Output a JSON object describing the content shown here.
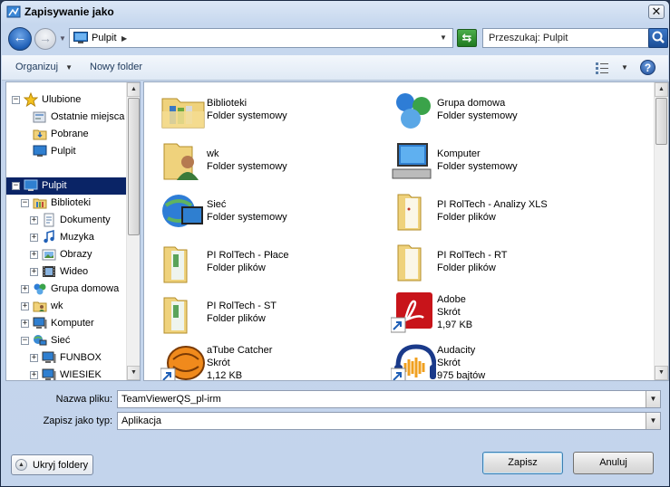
{
  "window": {
    "title": "Zapisywanie jako"
  },
  "address": {
    "location": "Pulpit"
  },
  "search": {
    "placeholder": "Przeszukaj: Pulpit"
  },
  "toolbar": {
    "organize": "Organizuj",
    "new_folder": "Nowy folder"
  },
  "nav": {
    "items": [
      {
        "label": "Ulubione",
        "icon": "star-icon"
      },
      {
        "label": "Ostatnie miejsca",
        "icon": "recent-places-icon"
      },
      {
        "label": "Pobrane",
        "icon": "downloads-folder-icon"
      },
      {
        "label": "Pulpit",
        "icon": "desktop-icon"
      },
      {
        "label": "Pulpit",
        "icon": "desktop-icon"
      },
      {
        "label": "Biblioteki",
        "icon": "libraries-icon"
      },
      {
        "label": "Dokumenty",
        "icon": "documents-icon"
      },
      {
        "label": "Muzyka",
        "icon": "music-icon"
      },
      {
        "label": "Obrazy",
        "icon": "pictures-icon"
      },
      {
        "label": "Wideo",
        "icon": "video-icon"
      },
      {
        "label": "Grupa domowa",
        "icon": "homegroup-icon"
      },
      {
        "label": "wk",
        "icon": "user-folder-icon"
      },
      {
        "label": "Komputer",
        "icon": "computer-icon"
      },
      {
        "label": "Sieć",
        "icon": "network-icon"
      },
      {
        "label": "FUNBOX",
        "icon": "network-computer-icon"
      },
      {
        "label": "WIESIEK",
        "icon": "network-computer-icon"
      }
    ]
  },
  "files": [
    {
      "name": "Biblioteki",
      "type": "Folder systemowy",
      "icon": "libraries-icon"
    },
    {
      "name": "Grupa domowa",
      "type": "Folder systemowy",
      "icon": "homegroup-icon"
    },
    {
      "name": "wk",
      "type": "Folder systemowy",
      "icon": "user-folder-icon"
    },
    {
      "name": "Komputer",
      "type": "Folder systemowy",
      "icon": "computer-icon"
    },
    {
      "name": "Sieć",
      "type": "Folder systemowy",
      "icon": "network-icon"
    },
    {
      "name": "PI RolTech - Analizy XLS",
      "type": "Folder plików",
      "icon": "folder-icon"
    },
    {
      "name": "PI RolTech - Płace",
      "type": "Folder plików",
      "icon": "folder-icon"
    },
    {
      "name": "PI RolTech - RT",
      "type": "Folder plików",
      "icon": "folder-icon"
    },
    {
      "name": "PI RolTech - ST",
      "type": "Folder plików",
      "icon": "folder-icon"
    },
    {
      "name": "Adobe",
      "type": "Skrót",
      "size": "1,97 KB",
      "icon": "adobe-reader-shortcut-icon"
    },
    {
      "name": "aTube Catcher",
      "type": "Skrót",
      "size": "1,12 KB",
      "icon": "atube-catcher-shortcut-icon"
    },
    {
      "name": "Audacity",
      "type": "Skrót",
      "size": "975 bajtów",
      "icon": "audacity-shortcut-icon"
    }
  ],
  "form": {
    "filename_label": "Nazwa pliku:",
    "filename_value": "TeamViewerQS_pl-irm",
    "filetype_label": "Zapisz jako typ:",
    "filetype_value": "Aplikacja"
  },
  "buttons": {
    "hide_folders": "Ukryj foldery",
    "save": "Zapisz",
    "cancel": "Anuluj"
  },
  "colors": {
    "selection": "#0a2466",
    "accent": "#1f5fb6"
  }
}
